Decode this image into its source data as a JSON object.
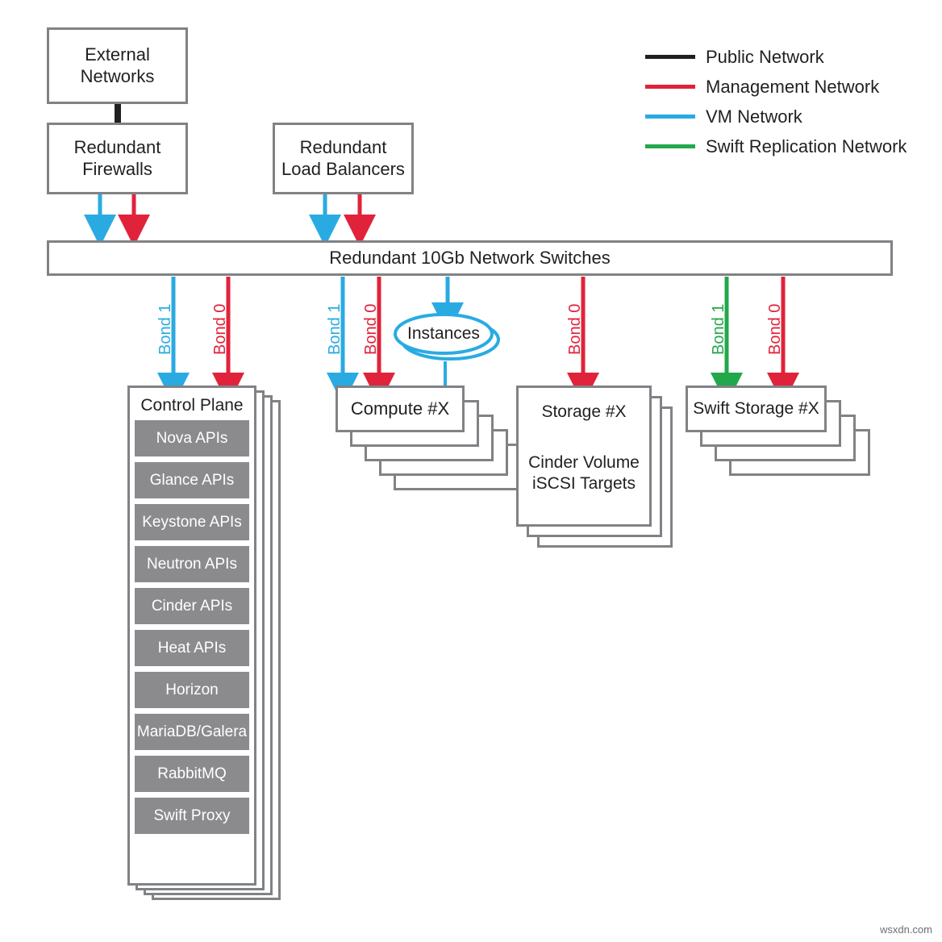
{
  "colors": {
    "public_network": "#231f20",
    "management_network": "#e0233a",
    "vm_network": "#29abe2",
    "swift_replication_network": "#22a84a",
    "box_border": "#808285",
    "api_fill": "#8b8b8d",
    "text": "#231f20"
  },
  "legend": {
    "items": [
      {
        "label": "Public Network",
        "color": "#231f20",
        "key": "public"
      },
      {
        "label": "Management Network",
        "color": "#e0233a",
        "key": "management"
      },
      {
        "label": "VM Network",
        "color": "#29abe2",
        "key": "vm"
      },
      {
        "label": "Swift Replication Network",
        "color": "#22a84a",
        "key": "swift-replication"
      }
    ]
  },
  "nodes": {
    "external_networks": {
      "lines": [
        "External",
        "Networks"
      ]
    },
    "redundant_firewalls": {
      "lines": [
        "Redundant",
        "Firewalls"
      ]
    },
    "redundant_load_balancers": {
      "lines": [
        "Redundant",
        "Load Balancers"
      ]
    },
    "switch_bar": {
      "label": "Redundant 10Gb Network Switches"
    },
    "instances": {
      "label": "Instances"
    },
    "control_plane": {
      "title": "Control Plane",
      "stack_count": 4,
      "services": [
        "Nova APIs",
        "Glance APIs",
        "Keystone APIs",
        "Neutron APIs",
        "Cinder APIs",
        "Heat APIs",
        "Horizon",
        "MariaDB/Galera",
        "RabbitMQ",
        "Swift Proxy"
      ]
    },
    "compute": {
      "title": "Compute #X",
      "stack_count": 5
    },
    "storage": {
      "title": "Storage #X",
      "subtitle_lines": [
        "Cinder Volume",
        "iSCSI Targets"
      ],
      "stack_count": 3
    },
    "swift_storage": {
      "title": "Swift Storage #X",
      "stack_count": 4
    }
  },
  "bond_labels": [
    {
      "text": "Bond 1",
      "color": "#29abe2",
      "target": "control-plane"
    },
    {
      "text": "Bond 0",
      "color": "#e0233a",
      "target": "control-plane"
    },
    {
      "text": "Bond 1",
      "color": "#29abe2",
      "target": "compute"
    },
    {
      "text": "Bond 0",
      "color": "#e0233a",
      "target": "compute"
    },
    {
      "text": "Bond 0",
      "color": "#e0233a",
      "target": "storage"
    },
    {
      "text": "Bond 1",
      "color": "#22a84a",
      "target": "swift-storage"
    },
    {
      "text": "Bond 0",
      "color": "#e0233a",
      "target": "swift-storage"
    }
  ],
  "watermark": {
    "text": "wsxdn.com"
  }
}
